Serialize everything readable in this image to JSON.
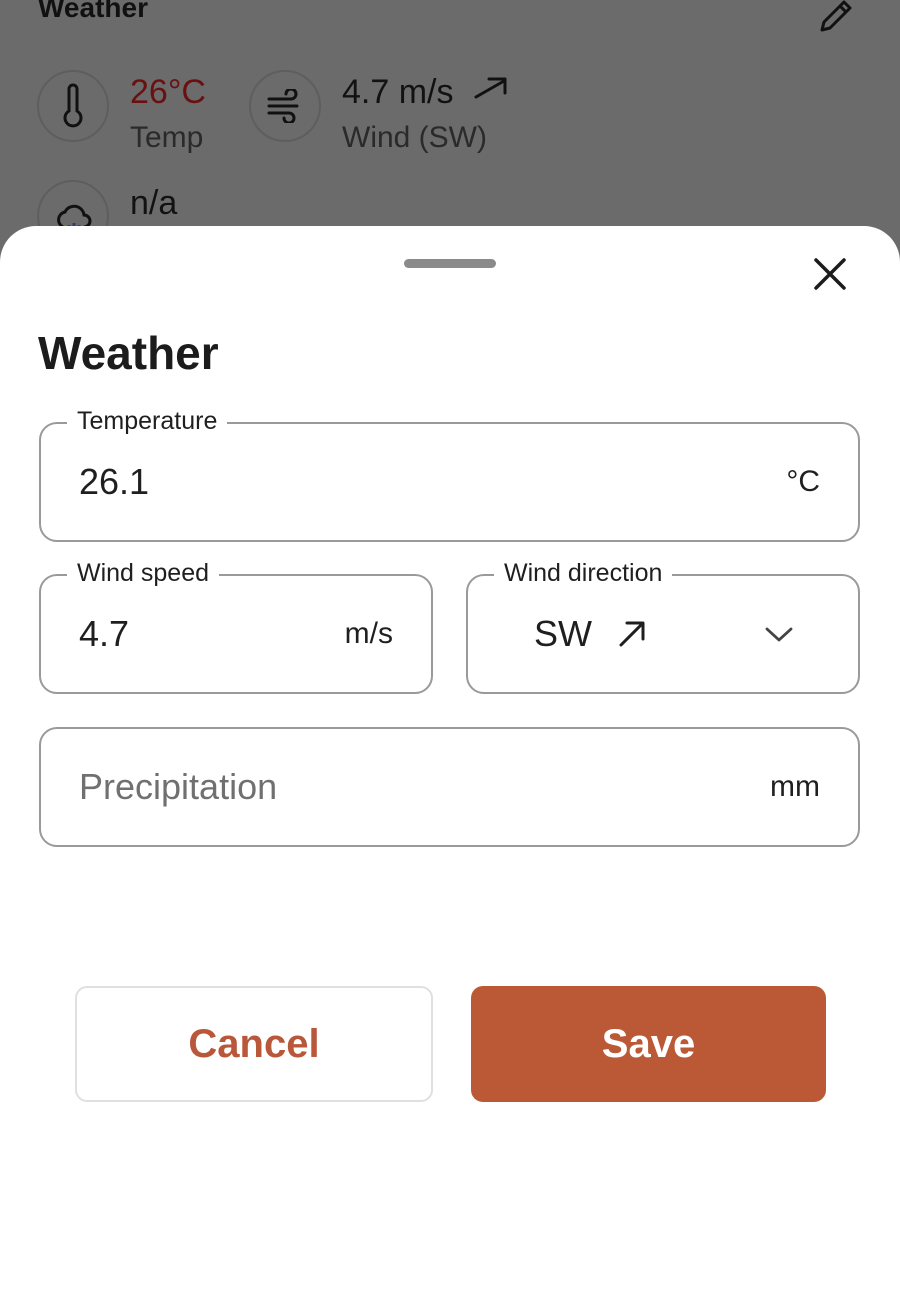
{
  "background": {
    "title": "Weather",
    "stats": {
      "temp": {
        "value": "26°C",
        "label": "Temp",
        "icon": "thermometer-icon"
      },
      "wind": {
        "value": "4.7 m/s",
        "label": "Wind (SW)",
        "icon": "wind-icon"
      },
      "precip": {
        "value": "n/a",
        "icon": "rain-cloud-icon"
      }
    },
    "edit_icon": "pencil-icon"
  },
  "sheet": {
    "title": "Weather",
    "close_icon": "close-icon",
    "fields": {
      "temperature": {
        "label": "Temperature",
        "value": "26.1",
        "unit": "°C"
      },
      "wind_speed": {
        "label": "Wind speed",
        "value": "4.7",
        "unit": "m/s"
      },
      "wind_direction": {
        "label": "Wind direction",
        "value": "SW",
        "icon": "arrow-up-right-icon"
      },
      "precipitation": {
        "placeholder": "Precipitation",
        "value": "",
        "unit": "mm"
      }
    },
    "buttons": {
      "cancel": "Cancel",
      "save": "Save"
    }
  },
  "colors": {
    "accent": "#bb5937",
    "temp_red": "#8b1a1a"
  }
}
